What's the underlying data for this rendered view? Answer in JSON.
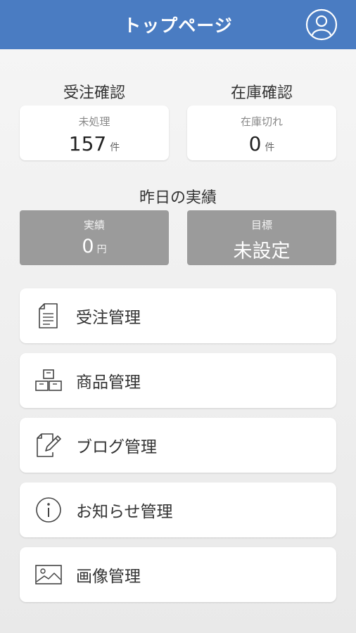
{
  "header": {
    "title": "トップページ",
    "profile_icon": "user-circle-icon",
    "bg_color": "#4a7cc2"
  },
  "orders": {
    "title": "受注確認",
    "label": "未処理",
    "value": "157",
    "unit": "件"
  },
  "stock": {
    "title": "在庫確認",
    "label": "在庫切れ",
    "value": "0",
    "unit": "件"
  },
  "yesterday": {
    "title": "昨日の実績",
    "actual": {
      "label": "実績",
      "value": "0",
      "unit": "円"
    },
    "target": {
      "label": "目標",
      "value": "未設定"
    }
  },
  "menu": [
    {
      "label": "受注管理",
      "icon": "document-icon"
    },
    {
      "label": "商品管理",
      "icon": "boxes-icon"
    },
    {
      "label": "ブログ管理",
      "icon": "edit-icon"
    },
    {
      "label": "お知らせ管理",
      "icon": "info-icon"
    },
    {
      "label": "画像管理",
      "icon": "image-icon"
    }
  ]
}
